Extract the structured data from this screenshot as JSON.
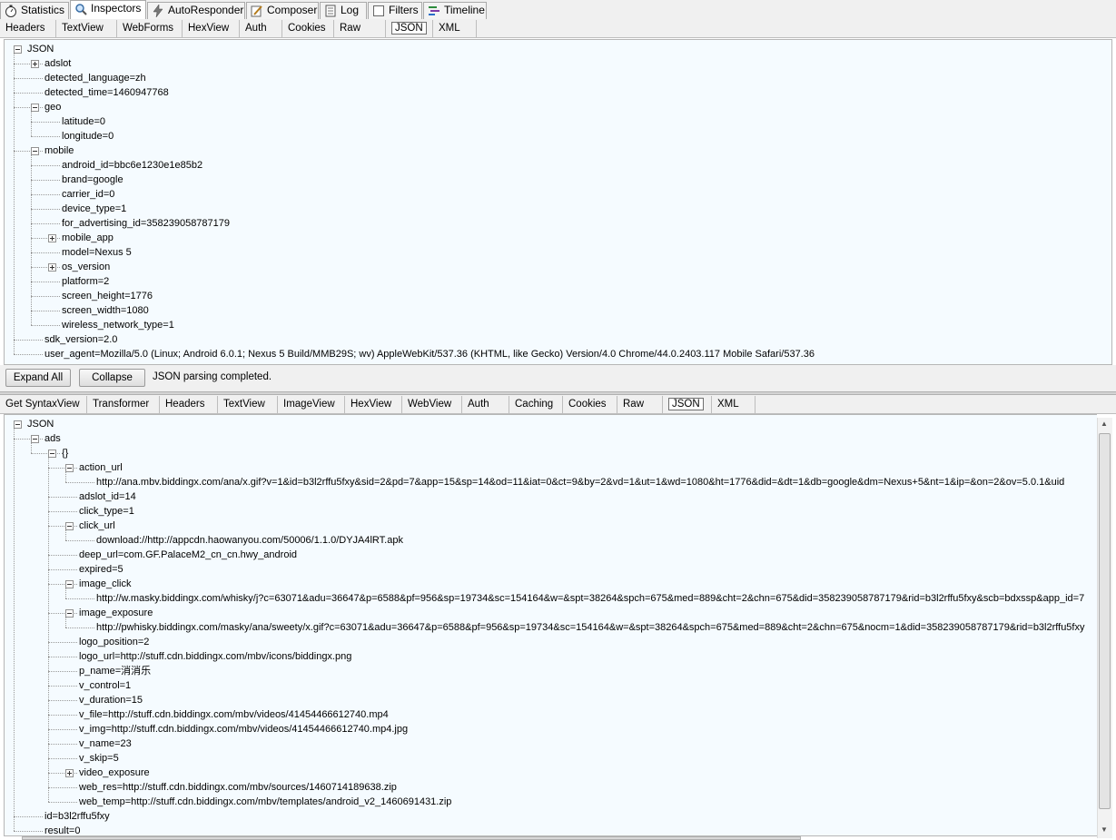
{
  "main_tabs": [
    {
      "label": "Statistics",
      "icon": "stopwatch-icon"
    },
    {
      "label": "Inspectors",
      "icon": "magnifier-icon"
    },
    {
      "label": "AutoResponder",
      "icon": "lightning-icon"
    },
    {
      "label": "Composer",
      "icon": "pencil-icon"
    },
    {
      "label": "Log",
      "icon": "log-icon"
    },
    {
      "label": "Filters",
      "icon": "checkbox-icon"
    },
    {
      "label": "Timeline",
      "icon": "timeline-icon"
    }
  ],
  "request_tabs": [
    "Headers",
    "TextView",
    "WebForms",
    "HexView",
    "Auth",
    "Cookies",
    "Raw",
    "JSON",
    "XML"
  ],
  "response_tabs": [
    "Get SyntaxView",
    "Transformer",
    "Headers",
    "TextView",
    "ImageView",
    "HexView",
    "WebView",
    "Auth",
    "Caching",
    "Cookies",
    "Raw",
    "JSON",
    "XML"
  ],
  "request_tree": [
    {
      "text": "JSON",
      "depth": 0,
      "toggle": "minus"
    },
    {
      "text": "adslot",
      "depth": 1,
      "toggle": "plus"
    },
    {
      "text": "detected_language=zh",
      "depth": 1
    },
    {
      "text": "detected_time=1460947768",
      "depth": 1
    },
    {
      "text": "geo",
      "depth": 1,
      "toggle": "minus"
    },
    {
      "text": "latitude=0",
      "depth": 2
    },
    {
      "text": "longitude=0",
      "depth": 2
    },
    {
      "text": "mobile",
      "depth": 1,
      "toggle": "minus"
    },
    {
      "text": "android_id=bbc6e1230e1e85b2",
      "depth": 2
    },
    {
      "text": "brand=google",
      "depth": 2
    },
    {
      "text": "carrier_id=0",
      "depth": 2
    },
    {
      "text": "device_type=1",
      "depth": 2
    },
    {
      "text": "for_advertising_id=358239058787179",
      "depth": 2
    },
    {
      "text": "mobile_app",
      "depth": 2,
      "toggle": "plus"
    },
    {
      "text": "model=Nexus 5",
      "depth": 2
    },
    {
      "text": "os_version",
      "depth": 2,
      "toggle": "plus"
    },
    {
      "text": "platform=2",
      "depth": 2
    },
    {
      "text": "screen_height=1776",
      "depth": 2
    },
    {
      "text": "screen_width=1080",
      "depth": 2
    },
    {
      "text": "wireless_network_type=1",
      "depth": 2
    },
    {
      "text": "sdk_version=2.0",
      "depth": 1
    },
    {
      "text": "user_agent=Mozilla/5.0 (Linux; Android 6.0.1; Nexus 5 Build/MMB29S; wv) AppleWebKit/537.36 (KHTML, like Gecko) Version/4.0 Chrome/44.0.2403.117 Mobile Safari/537.36",
      "depth": 1
    }
  ],
  "toolbar": {
    "expand_all": "Expand All",
    "collapse": "Collapse",
    "status": "JSON parsing completed."
  },
  "response_tree": [
    {
      "text": "JSON",
      "depth": 0,
      "toggle": "minus"
    },
    {
      "text": "ads",
      "depth": 1,
      "toggle": "minus"
    },
    {
      "text": "{}",
      "depth": 2,
      "toggle": "minus"
    },
    {
      "text": "action_url",
      "depth": 3,
      "toggle": "minus"
    },
    {
      "text": "http://ana.mbv.biddingx.com/ana/x.gif?v=1&id=b3l2rffu5fxy&sid=2&pd=7&app=15&sp=14&od=11&iat=0&ct=9&by=2&vd=1&ut=1&wd=1080&ht=1776&did=&dt=1&db=google&dm=Nexus+5&nt=1&ip=&on=2&ov=5.0.1&uid",
      "depth": 4
    },
    {
      "text": "adslot_id=14",
      "depth": 3
    },
    {
      "text": "click_type=1",
      "depth": 3
    },
    {
      "text": "click_url",
      "depth": 3,
      "toggle": "minus"
    },
    {
      "text": "download://http://appcdn.haowanyou.com/50006/1.1.0/DYJA4lRT.apk",
      "depth": 4
    },
    {
      "text": "deep_url=com.GF.PalaceM2_cn_cn.hwy_android",
      "depth": 3
    },
    {
      "text": "expired=5",
      "depth": 3
    },
    {
      "text": "image_click",
      "depth": 3,
      "toggle": "minus"
    },
    {
      "text": "http://w.masky.biddingx.com/whisky/j?c=63071&adu=36647&p=6588&pf=956&sp=19734&sc=154164&w=&spt=38264&spch=675&med=889&cht=2&chn=675&did=358239058787179&rid=b3l2rffu5fxy&scb=bdxssp&app_id=7",
      "depth": 4
    },
    {
      "text": "image_exposure",
      "depth": 3,
      "toggle": "minus"
    },
    {
      "text": "http://pwhisky.biddingx.com/masky/ana/sweety/x.gif?c=63071&adu=36647&p=6588&pf=956&sp=19734&sc=154164&w=&spt=38264&spch=675&med=889&cht=2&chn=675&nocm=1&did=358239058787179&rid=b3l2rffu5fxy",
      "depth": 4
    },
    {
      "text": "logo_position=2",
      "depth": 3
    },
    {
      "text": "logo_url=http://stuff.cdn.biddingx.com/mbv/icons/biddingx.png",
      "depth": 3
    },
    {
      "text": "p_name=消消乐",
      "depth": 3
    },
    {
      "text": "v_control=1",
      "depth": 3
    },
    {
      "text": "v_duration=15",
      "depth": 3
    },
    {
      "text": "v_file=http://stuff.cdn.biddingx.com/mbv/videos/41454466612740.mp4",
      "depth": 3
    },
    {
      "text": "v_img=http://stuff.cdn.biddingx.com/mbv/videos/41454466612740.mp4.jpg",
      "depth": 3
    },
    {
      "text": "v_name=23",
      "depth": 3
    },
    {
      "text": "v_skip=5",
      "depth": 3
    },
    {
      "text": "video_exposure",
      "depth": 3,
      "toggle": "plus"
    },
    {
      "text": "web_res=http://stuff.cdn.biddingx.com/mbv/sources/1460714189638.zip",
      "depth": 3
    },
    {
      "text": "web_temp=http://stuff.cdn.biddingx.com/mbv/templates/android_v2_1460691431.zip",
      "depth": 3
    },
    {
      "text": "id=b3l2rffu5fxy",
      "depth": 1
    },
    {
      "text": "result=0",
      "depth": 1
    }
  ],
  "scrollbar_arrows": {
    "up": "▲",
    "down": "▼"
  }
}
